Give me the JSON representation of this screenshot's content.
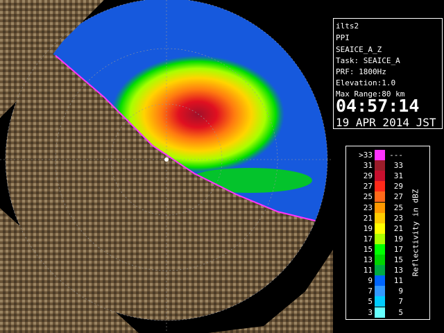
{
  "info": {
    "station": "ilts2",
    "product": "PPI",
    "task_name": "SEAICE_A_Z",
    "task": "Task: SEAICE_A",
    "prf": "PRF: 1800Hz",
    "elevation": "Elevation:1.0",
    "max_range": "Max Range:80 km",
    "time": "04:57:14",
    "date": "19 APR 2014 JST"
  },
  "legend": {
    "unit": "Reflectivity in dBZ",
    "rows": [
      {
        "lo": ">33",
        "hi": "---",
        "color": "#ff33ff"
      },
      {
        "lo": "31",
        "hi": "33",
        "color": "#9b1d2a"
      },
      {
        "lo": "29",
        "hi": "31",
        "color": "#c8102e"
      },
      {
        "lo": "27",
        "hi": "29",
        "color": "#ff2a1a"
      },
      {
        "lo": "25",
        "hi": "27",
        "color": "#ff6a1a"
      },
      {
        "lo": "23",
        "hi": "25",
        "color": "#ff9900"
      },
      {
        "lo": "21",
        "hi": "23",
        "color": "#ffcc00"
      },
      {
        "lo": "19",
        "hi": "21",
        "color": "#ffff00"
      },
      {
        "lo": "17",
        "hi": "19",
        "color": "#aaff00"
      },
      {
        "lo": "15",
        "hi": "17",
        "color": "#00ff00"
      },
      {
        "lo": "13",
        "hi": "15",
        "color": "#00d400"
      },
      {
        "lo": "11",
        "hi": "13",
        "color": "#00aa44"
      },
      {
        "lo": "9",
        "hi": "11",
        "color": "#0066ff"
      },
      {
        "lo": "7",
        "hi": "9",
        "color": "#3399ff"
      },
      {
        "lo": "5",
        "hi": "7",
        "color": "#00ccff"
      },
      {
        "lo": "3",
        "hi": "5",
        "color": "#66ffff"
      }
    ]
  }
}
